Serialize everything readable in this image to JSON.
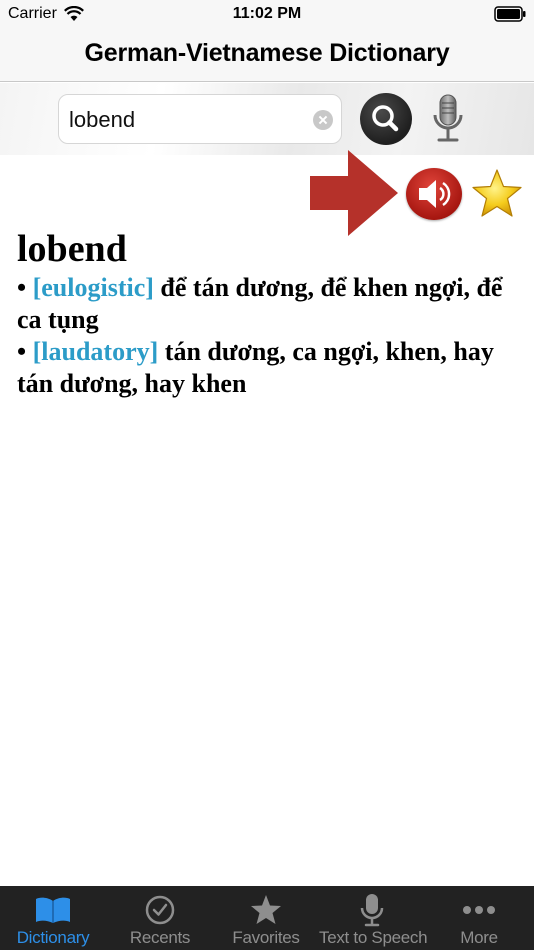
{
  "status_bar": {
    "carrier": "Carrier",
    "time": "11:02 PM"
  },
  "nav": {
    "title": "German-Vietnamese Dictionary"
  },
  "search": {
    "query": "lobend"
  },
  "entry": {
    "headword": "lobend",
    "senses": [
      {
        "bullet": "•",
        "tag": "[eulogistic]",
        "definition": "để tán dương, để khen ngợi, để ca tụng"
      },
      {
        "bullet": "•",
        "tag": "[laudatory]",
        "definition": "tán dương, ca ngợi, khen, hay tán dương, hay khen"
      }
    ]
  },
  "tabs": [
    {
      "label": "Dictionary",
      "icon": "book-icon",
      "active": true
    },
    {
      "label": "Recents",
      "icon": "clock-check-icon",
      "active": false
    },
    {
      "label": "Favorites",
      "icon": "star-icon",
      "active": false
    },
    {
      "label": "Text to Speech",
      "icon": "microphone-icon",
      "active": false
    },
    {
      "label": "More",
      "icon": "ellipsis-icon",
      "active": false
    }
  ],
  "colors": {
    "accent": "#2d8fe8",
    "tag": "#2c9cc8",
    "speaker": "#c4201a",
    "arrow": "#b5312a",
    "tabbar": "#222222"
  }
}
